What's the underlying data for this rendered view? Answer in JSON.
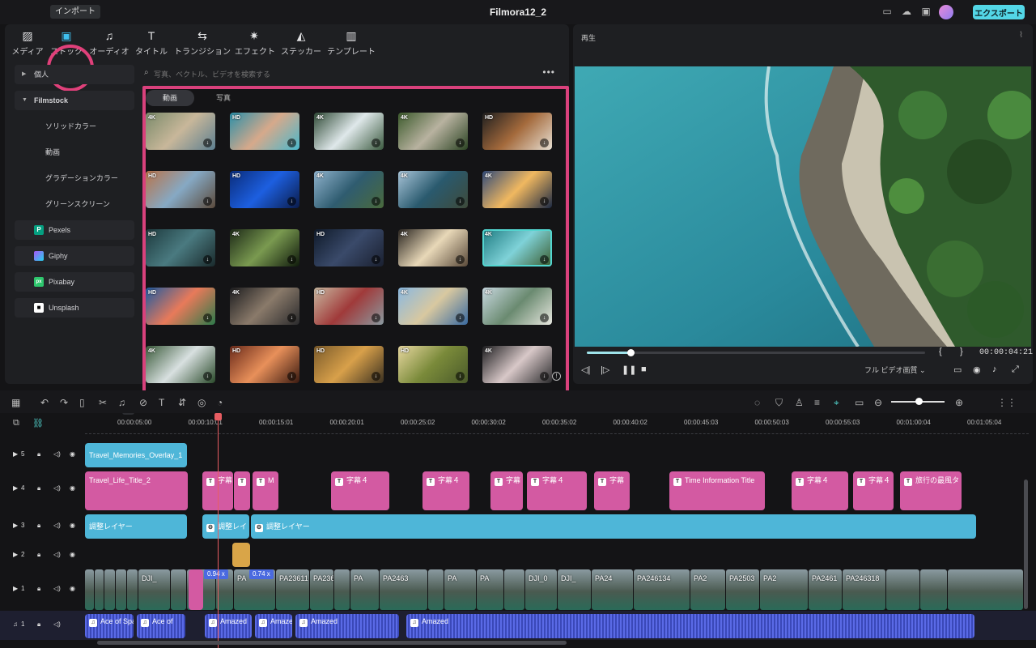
{
  "app": {
    "title": "Filmora12_2",
    "import_tooltip": "インポート",
    "export_label": "エクスポート"
  },
  "tabs": [
    {
      "label": "メディア",
      "icon": "image-icon"
    },
    {
      "label": "ストック",
      "icon": "stock-folder-icon"
    },
    {
      "label": "オーディオ",
      "icon": "music-note-icon"
    },
    {
      "label": "タイトル",
      "icon": "text-t-icon"
    },
    {
      "label": "トランジション",
      "icon": "transition-arrows-icon"
    },
    {
      "label": "エフェクト",
      "icon": "sparkle-icon"
    },
    {
      "label": "ステッカー",
      "icon": "sticker-icon"
    },
    {
      "label": "テンプレート",
      "icon": "template-icon"
    }
  ],
  "sidebar": {
    "personal": "個人",
    "filmstock": "Filmstock",
    "filmstock_items": [
      "ソリッドカラー",
      "動画",
      "グラデーションカラー",
      "グリーンスクリーン"
    ],
    "sources": [
      {
        "label": "Pexels",
        "icon": "pexels-logo-icon",
        "color": "#05a081"
      },
      {
        "label": "Giphy",
        "icon": "giphy-logo-icon",
        "color": "#a855f7"
      },
      {
        "label": "Pixabay",
        "icon": "pixabay-logo-icon",
        "color": "#2ec66d"
      },
      {
        "label": "Unsplash",
        "icon": "unsplash-logo-icon",
        "color": "#ffffff"
      }
    ]
  },
  "search": {
    "placeholder": "写真、ベクトル、ビデオを検索する"
  },
  "media_tabs": {
    "video": "動画",
    "photo": "写真"
  },
  "thumbnails": [
    {
      "res": "4K",
      "colors": [
        "#7a8a6a",
        "#c8b79a",
        "#5d7f90"
      ]
    },
    {
      "res": "HD",
      "colors": [
        "#2b8fa8",
        "#d6a98b",
        "#4ab8cc"
      ]
    },
    {
      "res": "4K",
      "colors": [
        "#2f4a36",
        "#dfe8ea",
        "#3c5b40"
      ]
    },
    {
      "res": "4K",
      "colors": [
        "#3c5a2c",
        "#b8b2a0",
        "#2c4424"
      ]
    },
    {
      "res": "HD",
      "colors": [
        "#1f1f1f",
        "#a46a3c",
        "#e7dfd2"
      ]
    },
    {
      "res": "HD",
      "colors": [
        "#b8734a",
        "#86a9c4",
        "#5b4a3c"
      ]
    },
    {
      "res": "HD",
      "colors": [
        "#0a2c7a",
        "#1d5fe0",
        "#0b1c4a"
      ]
    },
    {
      "res": "4K",
      "colors": [
        "#8fb2cc",
        "#2f5c70",
        "#4a6a3c"
      ]
    },
    {
      "res": "4K",
      "colors": [
        "#a8c4d8",
        "#2a5a6e",
        "#3e4a3a"
      ]
    },
    {
      "res": "4K",
      "colors": [
        "#314a78",
        "#f0b860",
        "#1d2a44"
      ]
    },
    {
      "res": "HD",
      "colors": [
        "#1d3a3e",
        "#4a7a80",
        "#1a2a2c"
      ]
    },
    {
      "res": "4K",
      "colors": [
        "#1d2a18",
        "#7a9a50",
        "#0f1a0c"
      ]
    },
    {
      "res": "HD",
      "colors": [
        "#0f1a2a",
        "#3a4a6a",
        "#1a2030"
      ]
    },
    {
      "res": "4K",
      "colors": [
        "#2a2520",
        "#e8d8b8",
        "#5a4a3a"
      ]
    },
    {
      "res": "4K",
      "colors": [
        "#1d7a80",
        "#7fd2d8",
        "#3a5a2c"
      ]
    },
    {
      "res": "HD",
      "colors": [
        "#1d5aa0",
        "#e87a5a",
        "#2c7a4a"
      ]
    },
    {
      "res": "4K",
      "colors": [
        "#1d1d1f",
        "#8a7a6a",
        "#2a2a2c"
      ]
    },
    {
      "res": "HD",
      "colors": [
        "#c8b8a0",
        "#a03a3a",
        "#8a9aa0"
      ]
    },
    {
      "res": "4K",
      "colors": [
        "#8ab8e0",
        "#d8c8a0",
        "#3a6aa0"
      ]
    },
    {
      "res": "4K",
      "colors": [
        "#c8d8e0",
        "#6a8a70",
        "#e8e8e0"
      ]
    },
    {
      "res": "4K",
      "colors": [
        "#3a5a3a",
        "#d8e0e0",
        "#2a4a2a"
      ]
    },
    {
      "res": "HD",
      "colors": [
        "#6a2a1a",
        "#e8905a",
        "#3a1a10"
      ]
    },
    {
      "res": "HD",
      "colors": [
        "#7a5a2a",
        "#d8a04a",
        "#3a3020"
      ]
    },
    {
      "res": "HD",
      "colors": [
        "#e8d8a0",
        "#7a8a3a",
        "#4a5a2a"
      ]
    },
    {
      "res": "4K",
      "colors": [
        "#1d1d1f",
        "#d8c8c8",
        "#2a2a2c"
      ]
    }
  ],
  "player": {
    "title": "再生",
    "timecode": "00:00:04:21",
    "quality": "フル ビデオ画質",
    "progress_fraction": 0.13
  },
  "ruler": [
    "00:00:05:00",
    "00:00:10:01",
    "00:00:15:01",
    "00:00:20:01",
    "00:00:25:02",
    "00:00:30:02",
    "00:00:35:02",
    "00:00:40:02",
    "00:00:45:03",
    "00:00:50:03",
    "00:00:55:03",
    "00:01:00:04",
    "00:01:05:04"
  ],
  "tracks": [
    {
      "label": "5",
      "icon": "video-track-icon"
    },
    {
      "label": "4",
      "icon": "video-track-icon"
    },
    {
      "label": "3",
      "icon": "video-track-icon"
    },
    {
      "label": "2",
      "icon": "video-track-icon"
    },
    {
      "label": "1",
      "icon": "video-track-icon"
    },
    {
      "label": "1",
      "icon": "music-note-icon"
    }
  ],
  "clips": {
    "t5": [
      "Travel_Memories_Overlay_1"
    ],
    "t4": [
      "Travel_Life_Title_2",
      "字幕",
      "M",
      "字幕４",
      "字幕４",
      "字幕",
      "字幕４",
      "字幕",
      "Time Information Title",
      "字幕４",
      "字幕４",
      "旅行の最風タ"
    ],
    "t3": [
      "調整レイヤー",
      "調整レイ",
      "調整レイヤー"
    ],
    "t1": [
      "DJI_",
      "PA",
      "PA",
      "PA23611",
      "PA236",
      "PA",
      "PA2463",
      "PA",
      "PA",
      "DJI_0",
      "DJI_",
      "PA24",
      "PA246134",
      "PA2",
      "PA2503",
      "PA2",
      "PA2461",
      "PA246318"
    ],
    "speed": [
      "0.94 x",
      "0.74 x"
    ],
    "audio": [
      "Ace of Spades",
      "Ace of",
      "Amazed",
      "Amazed",
      "Amazed",
      "Amazed"
    ]
  }
}
